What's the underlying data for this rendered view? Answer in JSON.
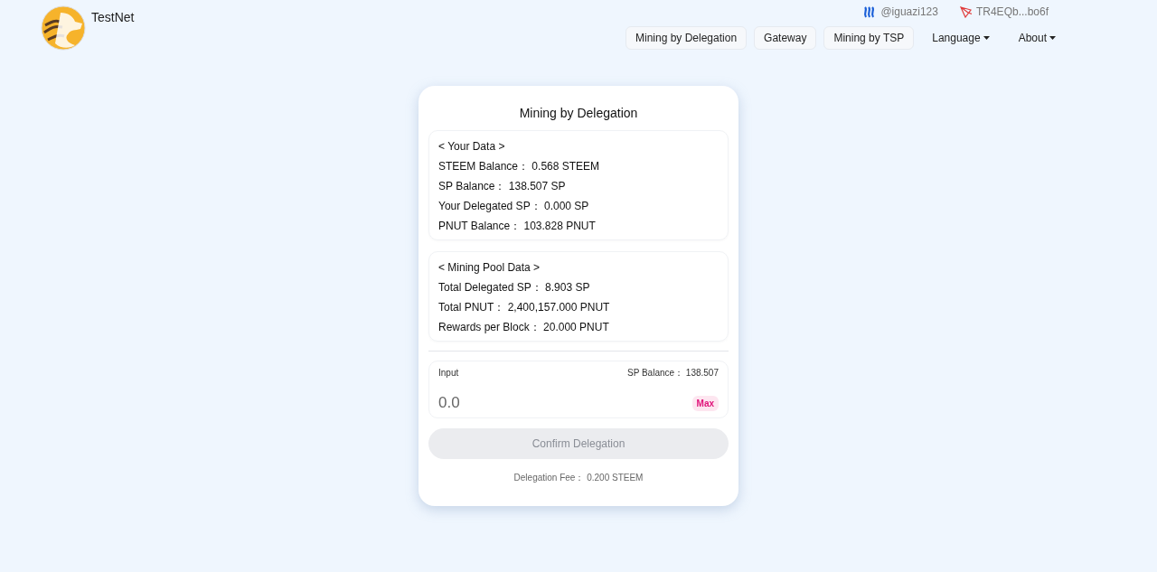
{
  "header": {
    "brand": "TestNet",
    "accounts": [
      {
        "kind": "steem",
        "label": "@iguazi123"
      },
      {
        "kind": "tron",
        "label": "TR4EQb...bo6f"
      }
    ],
    "nav": [
      {
        "kind": "button",
        "label": "Mining by Delegation"
      },
      {
        "kind": "button",
        "label": "Gateway"
      },
      {
        "kind": "button",
        "label": "Mining by TSP"
      },
      {
        "kind": "dropdown",
        "label": "Language"
      },
      {
        "kind": "dropdown",
        "label": "About"
      }
    ]
  },
  "panel": {
    "title": "Mining by Delegation",
    "sections": [
      {
        "heading": "< Your Data >",
        "rows": [
          "STEEM Balance：  0.568 STEEM",
          "SP Balance：  138.507 SP",
          "Your Delegated SP：  0.000 SP",
          "PNUT Balance：  103.828 PNUT"
        ]
      },
      {
        "heading": "< Mining Pool Data >",
        "rows": [
          "Total Delegated SP：  8.903 SP",
          "Total PNUT：  2,400,157.000 PNUT",
          "Rewards per Block：  20.000 PNUT"
        ]
      }
    ],
    "input": {
      "label": "Input",
      "balance": "SP Balance：  138.507",
      "placeholder": "0.0",
      "max": "Max"
    },
    "confirm": {
      "label": "Confirm Delegation",
      "disabled": true
    },
    "fee": "Delegation Fee：  0.200 STEEM"
  }
}
